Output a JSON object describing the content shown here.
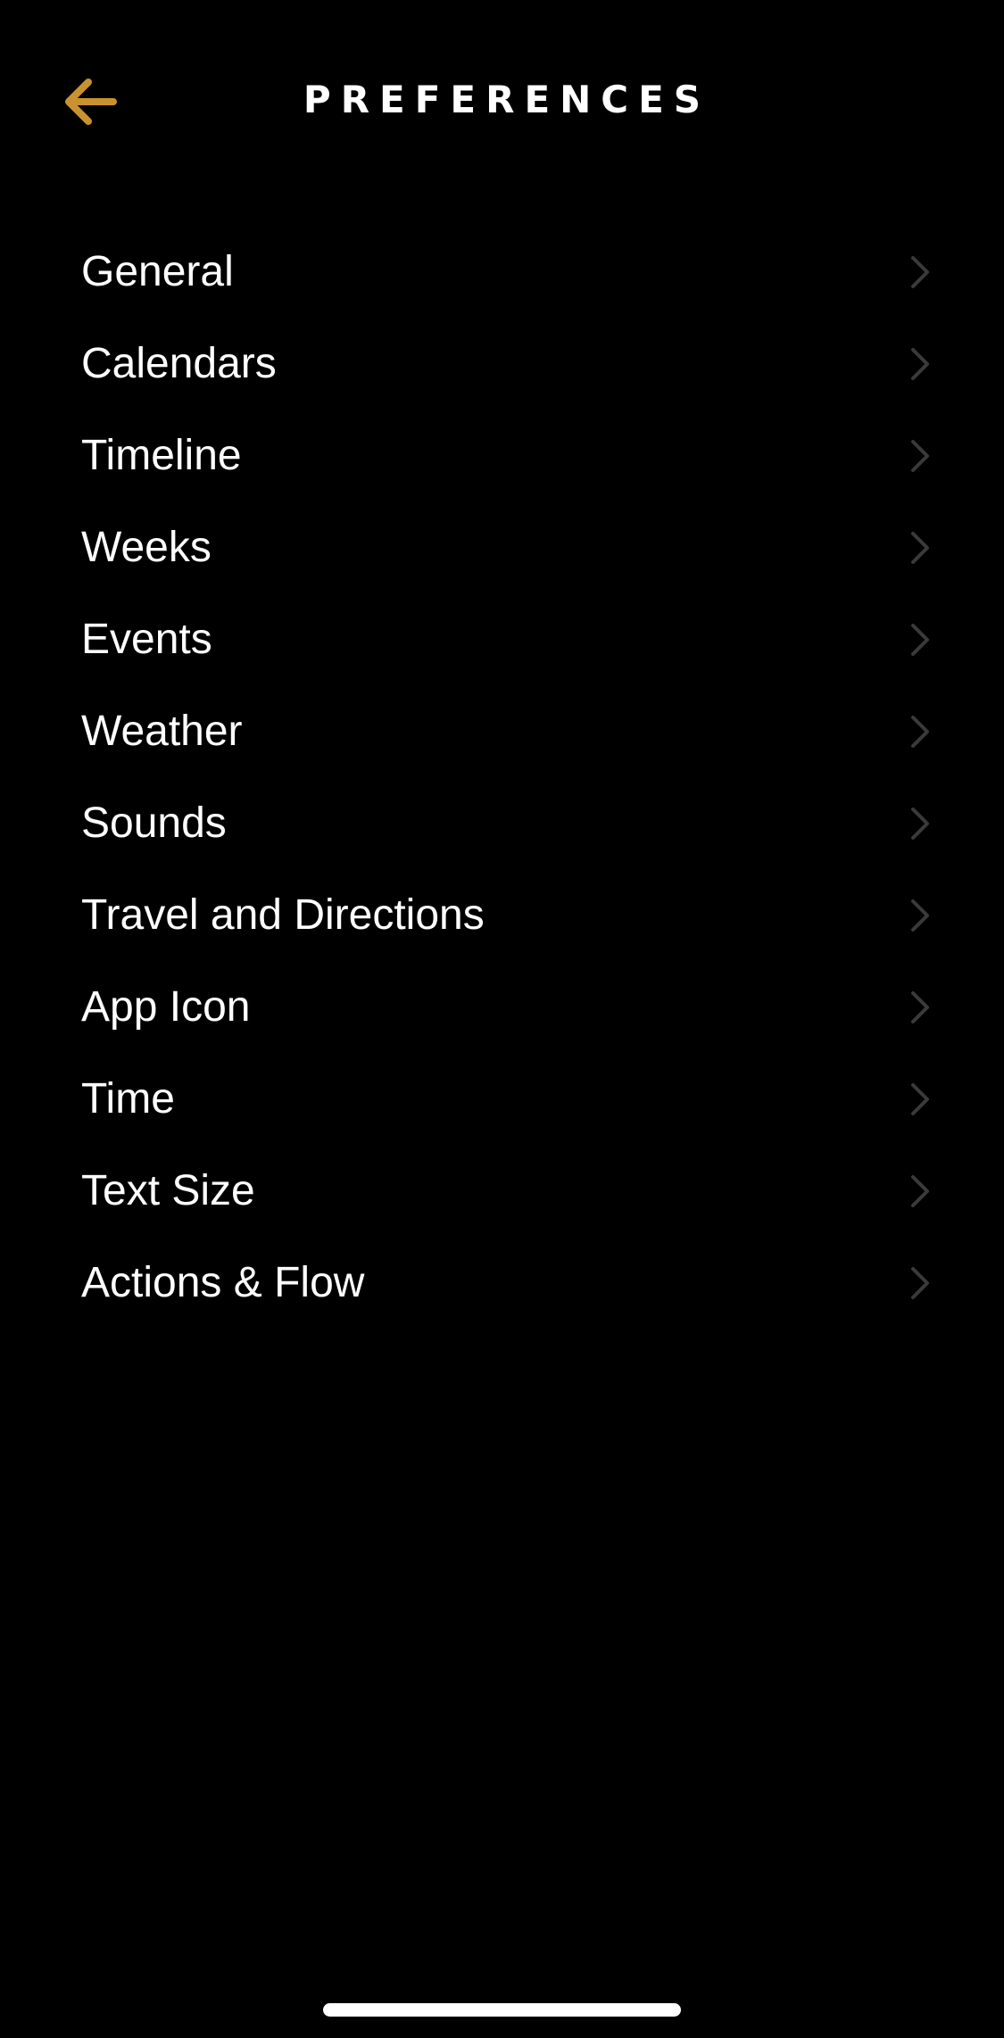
{
  "header": {
    "title": "PREFERENCES",
    "back_icon": "arrow-left-icon"
  },
  "menu": {
    "chevron_icon": "chevron-right-icon",
    "items": [
      {
        "label": "General"
      },
      {
        "label": "Calendars"
      },
      {
        "label": "Timeline"
      },
      {
        "label": "Weeks"
      },
      {
        "label": "Events"
      },
      {
        "label": "Weather"
      },
      {
        "label": "Sounds"
      },
      {
        "label": "Travel and Directions"
      },
      {
        "label": "App Icon"
      },
      {
        "label": "Time"
      },
      {
        "label": "Text Size"
      },
      {
        "label": "Actions & Flow"
      }
    ]
  },
  "colors": {
    "background": "#000000",
    "accent": "#C9922E",
    "text": "#FFFFFF",
    "chevron": "#3A3A3A"
  }
}
